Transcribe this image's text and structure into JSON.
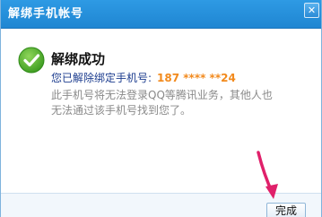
{
  "window": {
    "title": "解绑手机帐号",
    "close_glyph": "✕"
  },
  "message": {
    "headline": "解绑成功",
    "unbound_prefix": "您已解除绑定手机号:",
    "phone": "187 **** **24",
    "description": "此手机号将无法登录QQ等腾讯业务，其他人也无法通过该手机号找到您了。"
  },
  "footer": {
    "done_label": "完成"
  },
  "colors": {
    "title_bar": "#1f86d2",
    "phone_highlight": "#f28a1d",
    "success_green": "#4caf2a",
    "annotation_arrow": "#e0206a"
  },
  "icons": {
    "status": "check-circle-icon",
    "close": "close-icon",
    "annotation": "pointer-arrow"
  }
}
